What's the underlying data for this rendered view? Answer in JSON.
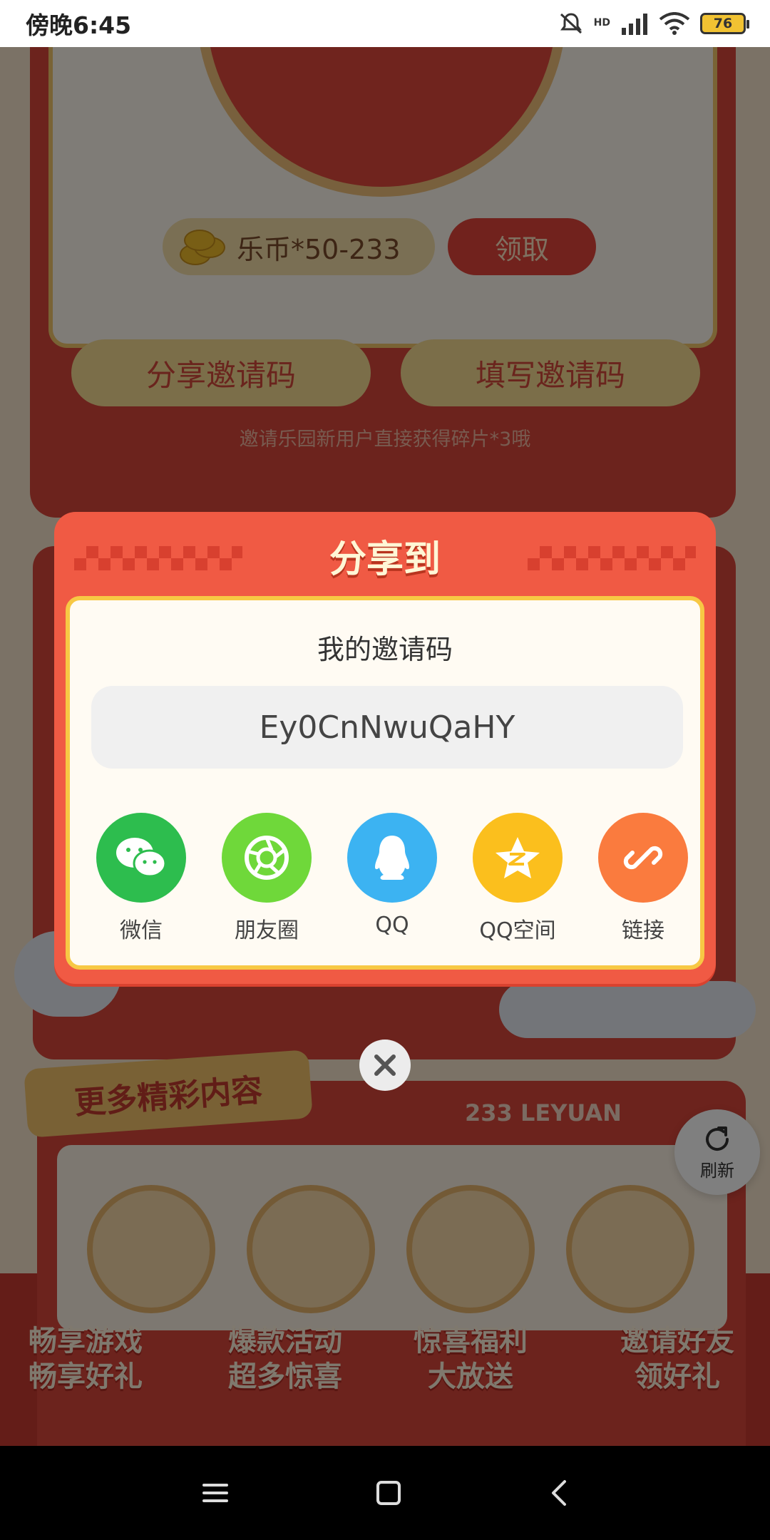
{
  "status_bar": {
    "time": "傍晚6:45",
    "network": "HD",
    "battery": "76"
  },
  "background": {
    "coin_reward": "乐币*50-233",
    "claim_button": "领取",
    "share_code_button": "分享邀请码",
    "fill_code_button": "填写邀请码",
    "hint": "邀请乐园新用户直接获得碎片*3哦",
    "more_title": "更多精彩内容",
    "brand_strip": "233 LEYUAN",
    "refresh_label": "刷新",
    "features": [
      {
        "line1": "畅享游戏",
        "line2": "畅享好礼"
      },
      {
        "line1": "爆款活动",
        "line2": "超多惊喜"
      },
      {
        "line1": "惊喜福利",
        "line2": "大放送"
      },
      {
        "line1": "邀请好友",
        "line2": "领好礼"
      }
    ]
  },
  "modal": {
    "title": "分享到",
    "code_label": "我的邀请码",
    "code": "Ey0CnNwuQaHY",
    "share_options": [
      {
        "label": "微信",
        "icon": "wechat-icon",
        "color": "#2dbd4e"
      },
      {
        "label": "朋友圈",
        "icon": "moments-icon",
        "color": "#6fd83a"
      },
      {
        "label": "QQ",
        "icon": "qq-icon",
        "color": "#3cb3f2"
      },
      {
        "label": "QQ空间",
        "icon": "qzone-icon",
        "color": "#fbbf1d"
      },
      {
        "label": "链接",
        "icon": "link-icon",
        "color": "#fa7b3e"
      }
    ]
  }
}
